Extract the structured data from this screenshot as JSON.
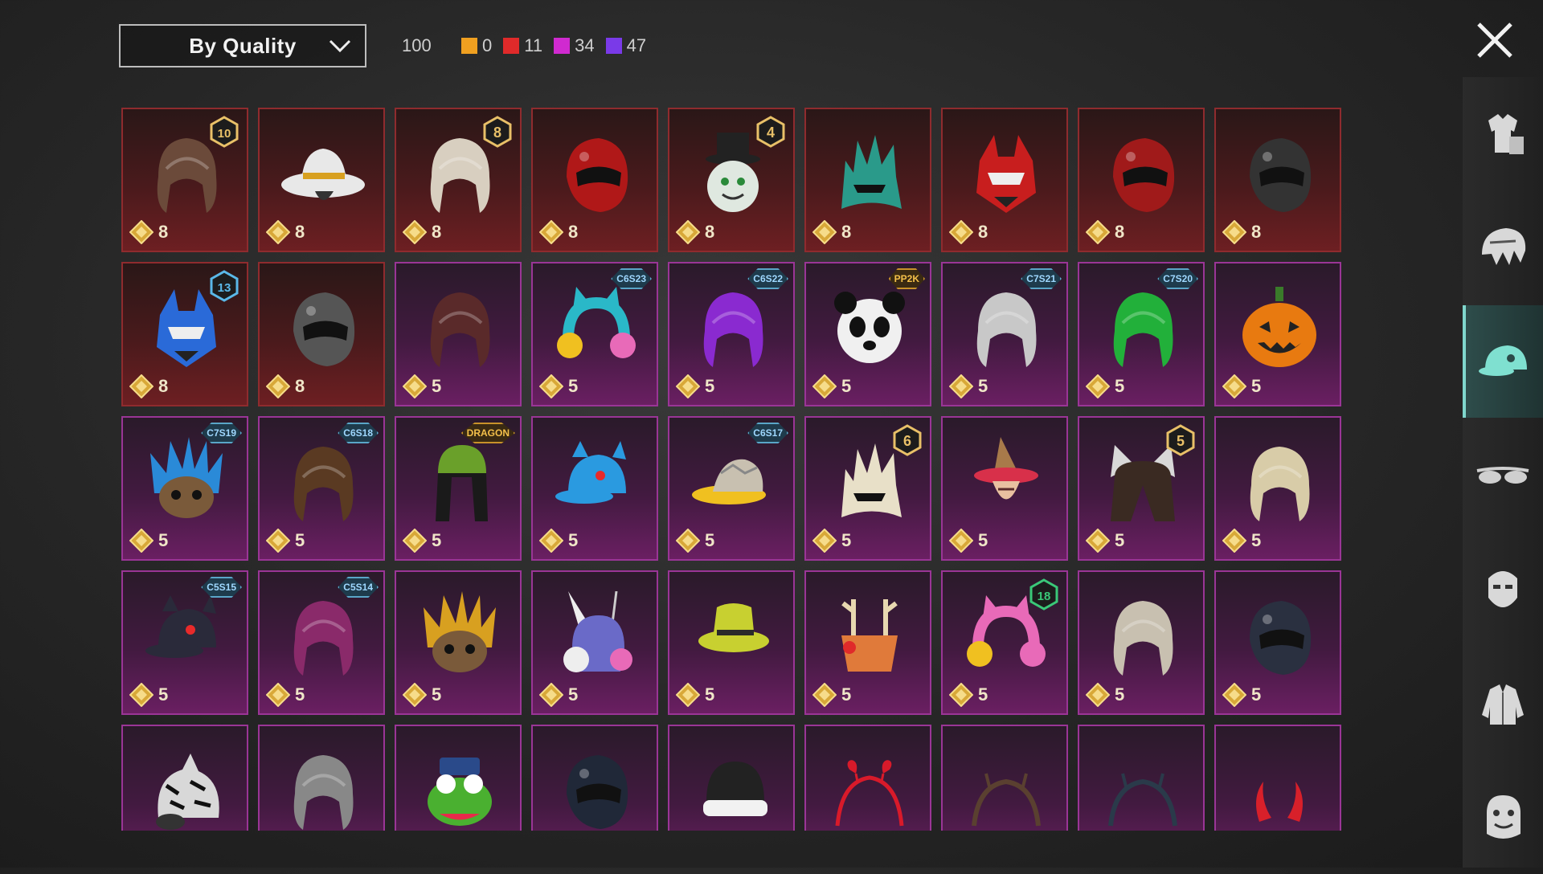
{
  "sort": {
    "label": "By Quality"
  },
  "total": "100",
  "quality_counts": [
    {
      "color": "#f0a020",
      "value": "0"
    },
    {
      "color": "#e02a2a",
      "value": "11"
    },
    {
      "color": "#d02ad0",
      "value": "34"
    },
    {
      "color": "#7a3ae8",
      "value": "47"
    }
  ],
  "sidebar": [
    {
      "icon": "outfit-icon",
      "active": false
    },
    {
      "icon": "hair-icon",
      "active": false
    },
    {
      "icon": "cap-icon",
      "active": true
    },
    {
      "icon": "glasses-icon",
      "active": false
    },
    {
      "icon": "face-icon",
      "active": false
    },
    {
      "icon": "jacket-icon",
      "active": false
    },
    {
      "icon": "emote-icon",
      "active": false
    }
  ],
  "items": [
    {
      "quality": "red",
      "cost": "8",
      "badge": "10",
      "art": "hair",
      "color": "#6b4a3a"
    },
    {
      "quality": "red",
      "cost": "8",
      "badge": "",
      "art": "cowboy-hat",
      "color": "#e8e8e8"
    },
    {
      "quality": "red",
      "cost": "8",
      "badge": "8",
      "art": "hair",
      "color": "#d8cfc0"
    },
    {
      "quality": "red",
      "cost": "8",
      "badge": "",
      "art": "helmet",
      "color": "#b01818"
    },
    {
      "quality": "red",
      "cost": "8",
      "badge": "4",
      "art": "snowman",
      "color": "#dfe8e0"
    },
    {
      "quality": "red",
      "cost": "8",
      "badge": "",
      "art": "spiky-mask",
      "color": "#2a9a8a"
    },
    {
      "quality": "red",
      "cost": "8",
      "badge": "",
      "art": "mecha-mask",
      "color": "#c81e1e"
    },
    {
      "quality": "red",
      "cost": "8",
      "badge": "",
      "art": "helmet",
      "color": "#a01a1a"
    },
    {
      "quality": "red",
      "cost": "8",
      "badge": "",
      "art": "helmet",
      "color": "#333"
    },
    {
      "quality": "red",
      "cost": "8",
      "badge": "13",
      "art": "mecha-mask",
      "color": "#2a6ad8"
    },
    {
      "quality": "red",
      "cost": "8",
      "badge": "",
      "art": "helmet",
      "color": "#555"
    },
    {
      "quality": "purple",
      "cost": "5",
      "badge": "",
      "art": "hair",
      "color": "#5a2a2a"
    },
    {
      "quality": "purple",
      "cost": "5",
      "tag": "C6S23",
      "art": "cat-headphones",
      "color": "#2ab8c8"
    },
    {
      "quality": "purple",
      "cost": "5",
      "tag": "C6S22",
      "art": "hair",
      "color": "#8a2ad0"
    },
    {
      "quality": "purple",
      "cost": "5",
      "tag": "PP2K",
      "tagStyle": "gold",
      "art": "panda",
      "color": "#f0f0f0"
    },
    {
      "quality": "purple",
      "cost": "5",
      "tag": "C7S21",
      "art": "hair",
      "color": "#c8c8c8"
    },
    {
      "quality": "purple",
      "cost": "5",
      "tag": "C7S20",
      "art": "hair",
      "color": "#22b03a"
    },
    {
      "quality": "purple",
      "cost": "5",
      "badge": "",
      "art": "pumpkin",
      "color": "#e87a10"
    },
    {
      "quality": "purple",
      "cost": "5",
      "tag": "C7S19",
      "art": "feather-mask",
      "color": "#2a8ad8"
    },
    {
      "quality": "purple",
      "cost": "5",
      "tag": "C6S18",
      "art": "hair",
      "color": "#5a3a22"
    },
    {
      "quality": "purple",
      "cost": "5",
      "tag": "DRAGON",
      "tagStyle": "gold",
      "art": "beanie-hair",
      "color": "#6aa02a"
    },
    {
      "quality": "purple",
      "cost": "5",
      "badge": "",
      "art": "cap",
      "color": "#2a9ae0"
    },
    {
      "quality": "purple",
      "cost": "5",
      "tag": "C6S17",
      "art": "visor",
      "color": "#f0c020"
    },
    {
      "quality": "purple",
      "cost": "5",
      "badge": "6",
      "art": "spiky-mask",
      "color": "#e8e0c8"
    },
    {
      "quality": "purple",
      "cost": "5",
      "badge": "",
      "art": "witch-hat",
      "color": "#a87a4a"
    },
    {
      "quality": "purple",
      "cost": "5",
      "badge": "5",
      "art": "cat-ears",
      "color": "#3a2a22"
    },
    {
      "quality": "purple",
      "cost": "5",
      "badge": "",
      "art": "hair",
      "color": "#d8cca8"
    },
    {
      "quality": "purple",
      "cost": "5",
      "tag": "C5S15",
      "art": "cap",
      "color": "#2a2a3a"
    },
    {
      "quality": "purple",
      "cost": "5",
      "tag": "C5S14",
      "art": "hair",
      "color": "#8a2a6a"
    },
    {
      "quality": "purple",
      "cost": "5",
      "badge": "",
      "art": "feather-mask",
      "color": "#d8a020"
    },
    {
      "quality": "purple",
      "cost": "5",
      "badge": "",
      "art": "bunny-headphones",
      "color": "#6a6ac8"
    },
    {
      "quality": "purple",
      "cost": "5",
      "badge": "",
      "art": "bucket-hat",
      "color": "#c8d030"
    },
    {
      "quality": "purple",
      "cost": "5",
      "badge": "",
      "art": "antlers",
      "color": "#e07a3a"
    },
    {
      "quality": "purple",
      "cost": "5",
      "badge": "18",
      "art": "cat-headphones",
      "color": "#e86ab8"
    },
    {
      "quality": "purple",
      "cost": "5",
      "badge": "",
      "art": "hair",
      "color": "#c8c0b0"
    },
    {
      "quality": "purple",
      "cost": "5",
      "badge": "",
      "art": "helmet",
      "color": "#2a3040"
    },
    {
      "quality": "purple",
      "cost": "",
      "badge": "",
      "art": "zebra",
      "color": "#d8d8d8"
    },
    {
      "quality": "purple",
      "cost": "",
      "badge": "",
      "art": "hair",
      "color": "#888"
    },
    {
      "quality": "purple",
      "cost": "",
      "badge": "",
      "art": "frog",
      "color": "#4ab030"
    },
    {
      "quality": "purple",
      "cost": "",
      "badge": "",
      "art": "helmet",
      "color": "#202838"
    },
    {
      "quality": "purple",
      "cost": "",
      "badge": "",
      "art": "beanie",
      "color": "#222"
    },
    {
      "quality": "purple",
      "cost": "",
      "badge": "",
      "art": "heart-band",
      "color": "#d81a2a"
    },
    {
      "quality": "purple",
      "cost": "",
      "badge": "",
      "art": "headband",
      "color": "#5a4030"
    },
    {
      "quality": "purple",
      "cost": "",
      "badge": "",
      "art": "headband",
      "color": "#2a3a4a"
    },
    {
      "quality": "purple",
      "cost": "",
      "badge": "",
      "art": "devil-horns",
      "color": "#d8202a"
    }
  ]
}
